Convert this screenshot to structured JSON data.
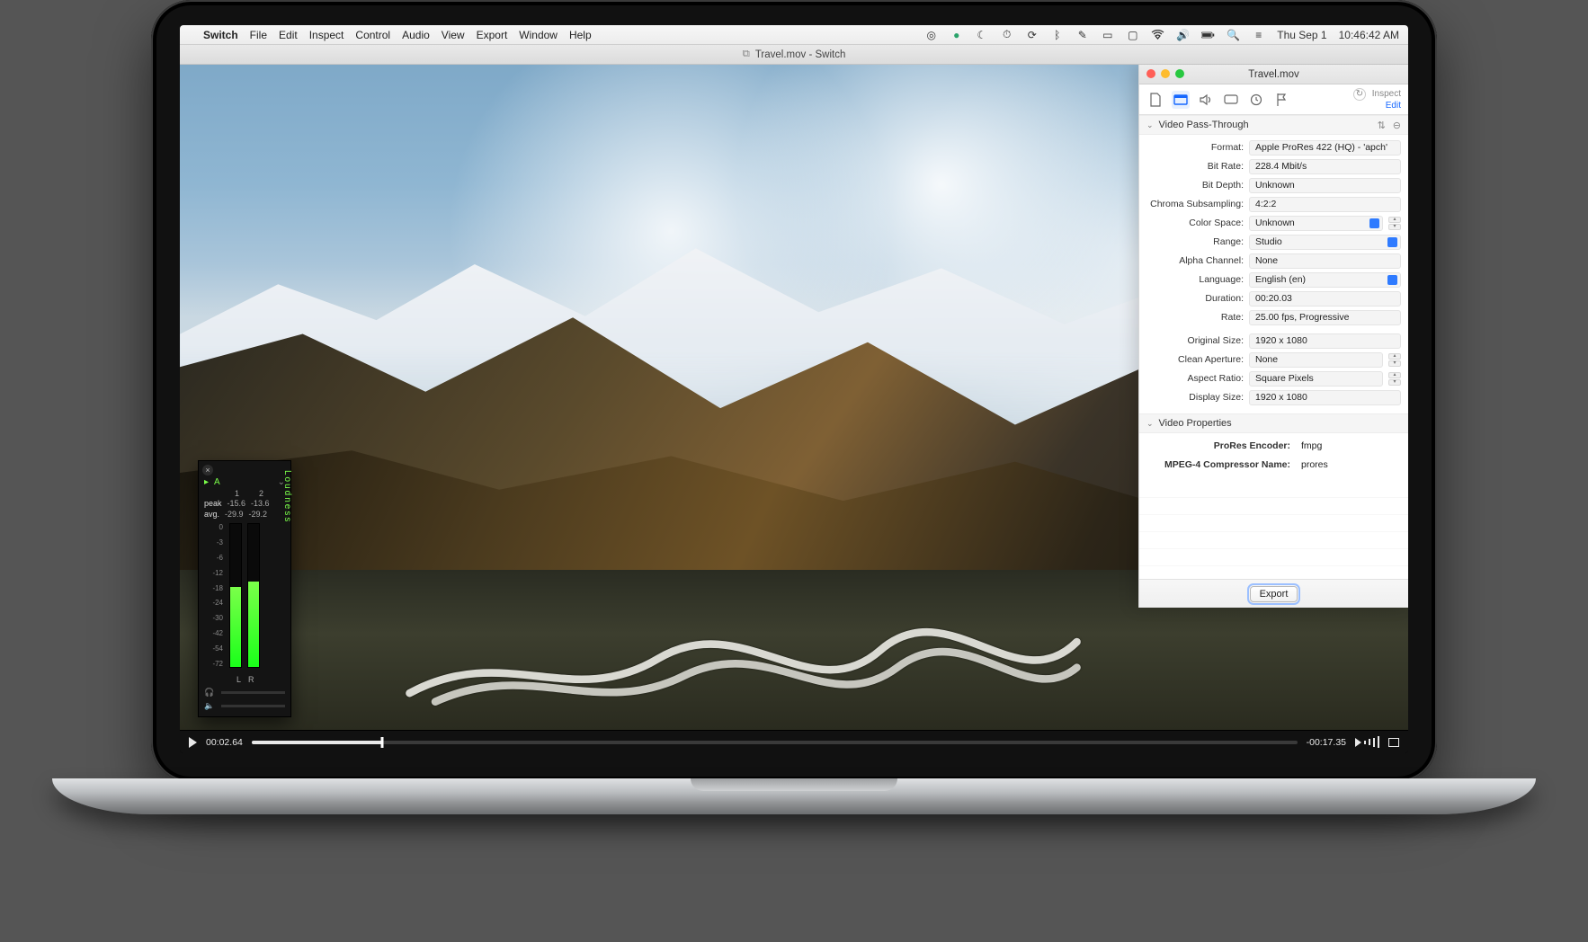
{
  "menubar": {
    "app": "Switch",
    "items": [
      "File",
      "Edit",
      "Inspect",
      "Control",
      "Audio",
      "View",
      "Export",
      "Window",
      "Help"
    ],
    "clock_day": "Thu Sep 1",
    "clock_time": "10:46:42 AM"
  },
  "player": {
    "title": "Travel.mov - Switch",
    "elapsed": "00:02.64",
    "remaining": "-00:17.35",
    "progress_pct": 12.5
  },
  "loudness": {
    "title": "Loudness",
    "channel_group": "A",
    "channels": [
      "1",
      "2"
    ],
    "peak_label": "peak",
    "peak_values": [
      "-15.6",
      "-13.6"
    ],
    "avg_label": "avg.",
    "avg_values": [
      "-29.9",
      "-29.2"
    ],
    "scale": [
      "0",
      "-3",
      "-6",
      "-12",
      "-18",
      "-24",
      "-30",
      "-42",
      "-54",
      "-72"
    ],
    "lr": [
      "L",
      "R"
    ]
  },
  "inspector": {
    "title": "Travel.mov",
    "mode_label": "Inspect",
    "mode_action": "Edit",
    "export_btn": "Export",
    "section1": {
      "title": "Video Pass-Through"
    },
    "props": {
      "format_label": "Format:",
      "format": "Apple ProRes 422 (HQ) - 'apch'",
      "bitrate_label": "Bit Rate:",
      "bitrate": "228.4 Mbit/s",
      "bitdepth_label": "Bit Depth:",
      "bitdepth": "Unknown",
      "chroma_label": "Chroma Subsampling:",
      "chroma": "4:2:2",
      "colorspace_label": "Color Space:",
      "colorspace": "Unknown",
      "range_label": "Range:",
      "range": "Studio",
      "alpha_label": "Alpha Channel:",
      "alpha": "None",
      "language_label": "Language:",
      "language": "English (en)",
      "duration_label": "Duration:",
      "duration": "00:20.03",
      "rate_label": "Rate:",
      "rate": "25.00 fps, Progressive",
      "origsize_label": "Original Size:",
      "origsize": "1920 x 1080",
      "cleanap_label": "Clean Aperture:",
      "cleanap": "None",
      "aspect_label": "Aspect Ratio:",
      "aspect": "Square Pixels",
      "dispsize_label": "Display Size:",
      "dispsize": "1920 x 1080"
    },
    "section2": {
      "title": "Video Properties"
    },
    "props2": {
      "prores_label": "ProRes Encoder:",
      "prores": "fmpg",
      "mpeg4_label": "MPEG-4 Compressor Name:",
      "mpeg4": "prores"
    }
  }
}
